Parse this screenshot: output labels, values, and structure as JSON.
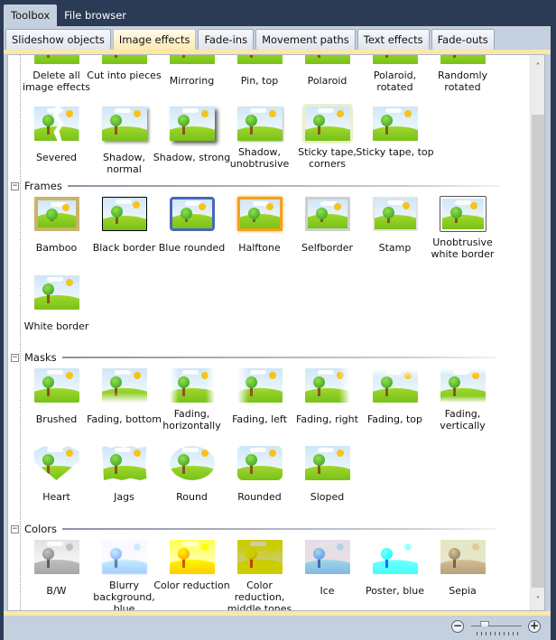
{
  "outer_tabs": [
    {
      "label": "Toolbox",
      "active": true
    },
    {
      "label": "File browser",
      "active": false
    }
  ],
  "inner_tabs": [
    {
      "label": "Slideshow objects",
      "active": false
    },
    {
      "label": "Image effects",
      "active": true
    },
    {
      "label": "Fade-ins",
      "active": false
    },
    {
      "label": "Movement paths",
      "active": false
    },
    {
      "label": "Text effects",
      "active": false
    },
    {
      "label": "Fade-outs",
      "active": false
    }
  ],
  "general_items": [
    {
      "label": "Delete all image effects",
      "icon": "delete-effects-icon"
    },
    {
      "label": "Cut into pieces",
      "icon": "cut-into-pieces-icon"
    },
    {
      "label": "Mirroring",
      "icon": "mirroring-icon"
    },
    {
      "label": "Pin, top",
      "icon": "pin-top-icon"
    },
    {
      "label": "Polaroid",
      "icon": "polaroid-icon"
    },
    {
      "label": "Polaroid, rotated",
      "icon": "polaroid-rotated-icon"
    },
    {
      "label": "Randomly rotated",
      "icon": "randomly-rotated-icon"
    },
    {
      "label": "Severed",
      "icon": "severed-icon"
    },
    {
      "label": "Shadow, normal",
      "icon": "shadow-normal-icon"
    },
    {
      "label": "Shadow, strong",
      "icon": "shadow-strong-icon"
    },
    {
      "label": "Shadow, unobtrusive",
      "icon": "shadow-unobtrusive-icon"
    },
    {
      "label": "Sticky tape, corners",
      "icon": "sticky-tape-corners-icon"
    },
    {
      "label": "Sticky tape, top",
      "icon": "sticky-tape-top-icon"
    }
  ],
  "sections": {
    "frames": {
      "title": "Frames",
      "toggle": "−",
      "items": [
        {
          "label": "Bamboo",
          "icon": "bamboo-frame-icon"
        },
        {
          "label": "Black border",
          "icon": "black-border-icon"
        },
        {
          "label": "Blue rounded",
          "icon": "blue-rounded-icon"
        },
        {
          "label": "Halftone",
          "icon": "halftone-icon"
        },
        {
          "label": "Selfborder",
          "icon": "selfborder-icon"
        },
        {
          "label": "Stamp",
          "icon": "stamp-icon"
        },
        {
          "label": "Unobtrusive white border",
          "icon": "unobtrusive-white-border-icon"
        },
        {
          "label": "White border",
          "icon": "white-border-icon"
        }
      ]
    },
    "masks": {
      "title": "Masks",
      "toggle": "−",
      "items": [
        {
          "label": "Brushed",
          "icon": "brushed-mask-icon"
        },
        {
          "label": "Fading, bottom",
          "icon": "fading-bottom-icon"
        },
        {
          "label": "Fading, horizontally",
          "icon": "fading-horizontally-icon"
        },
        {
          "label": "Fading, left",
          "icon": "fading-left-icon"
        },
        {
          "label": "Fading, right",
          "icon": "fading-right-icon"
        },
        {
          "label": "Fading, top",
          "icon": "fading-top-icon"
        },
        {
          "label": "Fading, vertically",
          "icon": "fading-vertically-icon"
        },
        {
          "label": "Heart",
          "icon": "heart-mask-icon"
        },
        {
          "label": "Jags",
          "icon": "jags-mask-icon"
        },
        {
          "label": "Round",
          "icon": "round-mask-icon"
        },
        {
          "label": "Rounded",
          "icon": "rounded-mask-icon"
        },
        {
          "label": "Sloped",
          "icon": "sloped-mask-icon"
        }
      ]
    },
    "colors": {
      "title": "Colors",
      "toggle": "−",
      "items": [
        {
          "label": "B/W",
          "icon": "bw-icon"
        },
        {
          "label": "Blurry background, blue",
          "icon": "blurry-background-blue-icon"
        },
        {
          "label": "Color reduction",
          "icon": "color-reduction-icon"
        },
        {
          "label": "Color reduction, middle tones",
          "icon": "color-reduction-middle-tones-icon"
        },
        {
          "label": "Ice",
          "icon": "ice-icon"
        },
        {
          "label": "Poster, blue",
          "icon": "poster-blue-icon"
        },
        {
          "label": "Sepia",
          "icon": "sepia-icon"
        }
      ]
    }
  },
  "scrollbar": {
    "up": "˄",
    "down": "˅"
  },
  "zoom_control": {
    "minus": "−",
    "plus": "+"
  },
  "colors": {
    "background": "#2b3a55",
    "panel": "#c5d0de",
    "active_tab": "#fde9b3",
    "accent_strip": "#fce7a6"
  }
}
